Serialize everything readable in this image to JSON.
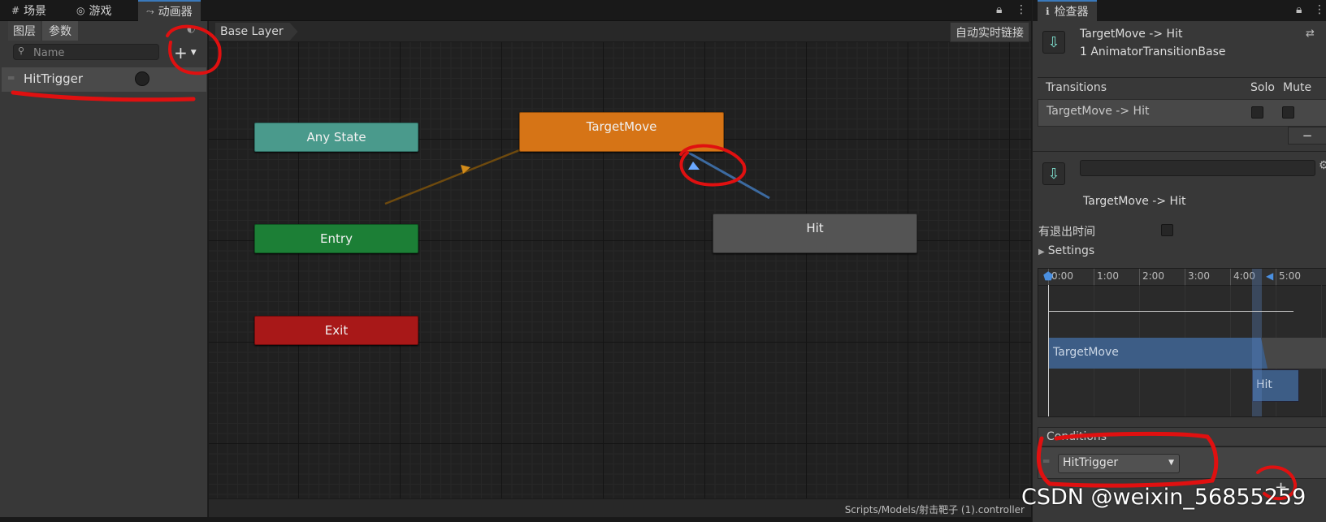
{
  "top_tabs": [
    {
      "label": "场景",
      "icon": "grid-icon"
    },
    {
      "label": "游戏",
      "icon": "gamepad-icon"
    },
    {
      "label": "动画器",
      "icon": "animator-icon",
      "active": true
    }
  ],
  "params_panel": {
    "tabs": [
      "图层",
      "参数"
    ],
    "active_tab": "参数",
    "search_placeholder": "Name",
    "add_label": "+",
    "parameters": [
      {
        "name": "HitTrigger",
        "type": "trigger"
      }
    ]
  },
  "graph": {
    "breadcrumb": "Base Layer",
    "auto_live_link": "自动实时链接",
    "nodes": {
      "any_state": "Any State",
      "entry": "Entry",
      "exit": "Exit",
      "target_move": "TargetMove",
      "hit": "Hit"
    },
    "status_path": "Scripts/Models/射击靶子 (1).controller"
  },
  "inspector": {
    "tab_label": "检查器",
    "header_title": "TargetMove -> Hit",
    "header_subtitle": "1 AnimatorTransitionBase",
    "transitions_header": "Transitions",
    "solo_label": "Solo",
    "mute_label": "Mute",
    "transition_row": "TargetMove -> Hit",
    "minus_label": "−",
    "transition_name": "TargetMove -> Hit",
    "has_exit_time_label": "有退出时间",
    "settings_label": "Settings",
    "timeline_ticks": [
      "0:00",
      "1:00",
      "2:00",
      "3:00",
      "4:00",
      "5:00"
    ],
    "bar_source": "TargetMove",
    "bar_dest": "Hit",
    "conditions_label": "Conditions",
    "condition_param": "HitTrigger",
    "plus_label": "+"
  },
  "watermark": "CSDN @weixin_56855259",
  "colors": {
    "any_state": "#4a9a8c",
    "entry": "#1c7f36",
    "exit": "#a81818",
    "target_move": "#d67416",
    "hit": "#545454",
    "accent": "#3a79bb",
    "annotation_red": "#e01010"
  }
}
